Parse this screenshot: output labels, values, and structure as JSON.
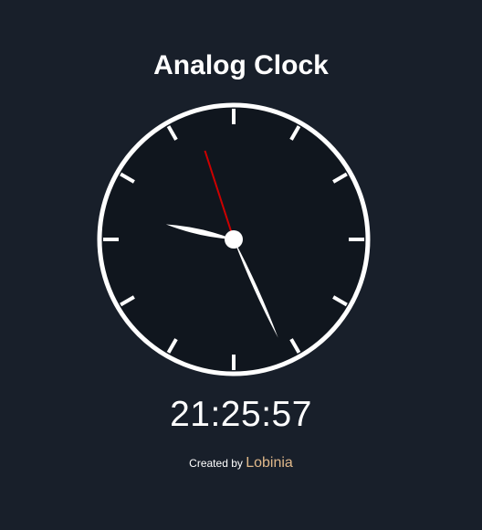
{
  "app": {
    "title": "Analog Clock"
  },
  "clock": {
    "time": {
      "hours": 21,
      "minutes": 25,
      "seconds": 57
    },
    "colors": {
      "face": "#10161e",
      "rim": "#ffffff",
      "ticks": "#ffffff",
      "hour_hand": "#ffffff",
      "minute_hand": "#ffffff",
      "second_hand": "#cc0000",
      "center_dot": "#ffffff"
    }
  },
  "digital_time": "21:25:57",
  "footer": {
    "created_by_label": "Created by",
    "author": "Lobinia",
    "author_color": "#e0b88a"
  },
  "colors": {
    "background": "#181f2a",
    "text": "#ffffff"
  }
}
